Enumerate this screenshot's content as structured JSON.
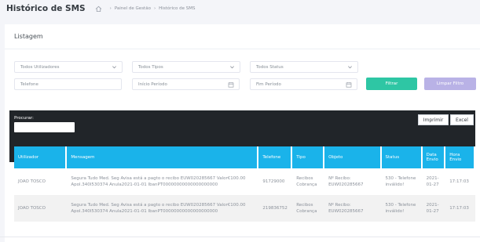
{
  "header": {
    "title": "Histórico de SMS",
    "breadcrumb": [
      "Painel de Gestão",
      "Histórico de SMS"
    ]
  },
  "card": {
    "title": "Listagem"
  },
  "filters": {
    "users": "Todos Utilizadores",
    "types": "Todos Tipos",
    "status": "Todos Status",
    "phone_placeholder": "Telefone",
    "start_placeholder": "Início Período",
    "end_placeholder": "Fim Período",
    "filter_btn": "Filtrar",
    "clear_btn": "Limpar Filtro"
  },
  "toolbar": {
    "search_label": "Procurar:",
    "print_btn": "Imprimir",
    "excel_btn": "Excel"
  },
  "table": {
    "headers": [
      "Utilizador",
      "Mensagem",
      "Telefone",
      "Tipo",
      "Objeto",
      "Status",
      "Data Envio",
      "Hora Envio"
    ],
    "rows": [
      [
        "JOAO TOSCO",
        "Segura Tudo Med. Seg Avisa está a pagto o recibo EUW020285667 Valor€100.00 Apol.340I530374 Anula2021-01-01 IbanPT00000000000000000000",
        "91729000",
        "Recibos Cobrança",
        "Nº Recibo: EUW020285667",
        "530 - Telefone inválido!",
        "2021-01-27",
        "17:17:03"
      ],
      [
        "JOAO TOSCO",
        "Segura Tudo Med. Seg Avisa está a pagto o recibo EUW020285667 Valor€100.00 Apol.340I530374 Anula2021-01-01 IbanPT00000000000000000000",
        "219836752",
        "Recibos Cobrança",
        "Nº Recibo: EUW020285667",
        "530 - Telefone inválido!",
        "2021-01-27",
        "17:17:03"
      ]
    ]
  },
  "colors": {
    "accent": "#1ab3ea",
    "filter": "#2ec6a4",
    "clear": "#b9b2e6",
    "dark": "#212529"
  },
  "icons": {
    "home": "home-icon",
    "chevron": "chevron-down-icon",
    "calendar": "calendar-icon"
  }
}
